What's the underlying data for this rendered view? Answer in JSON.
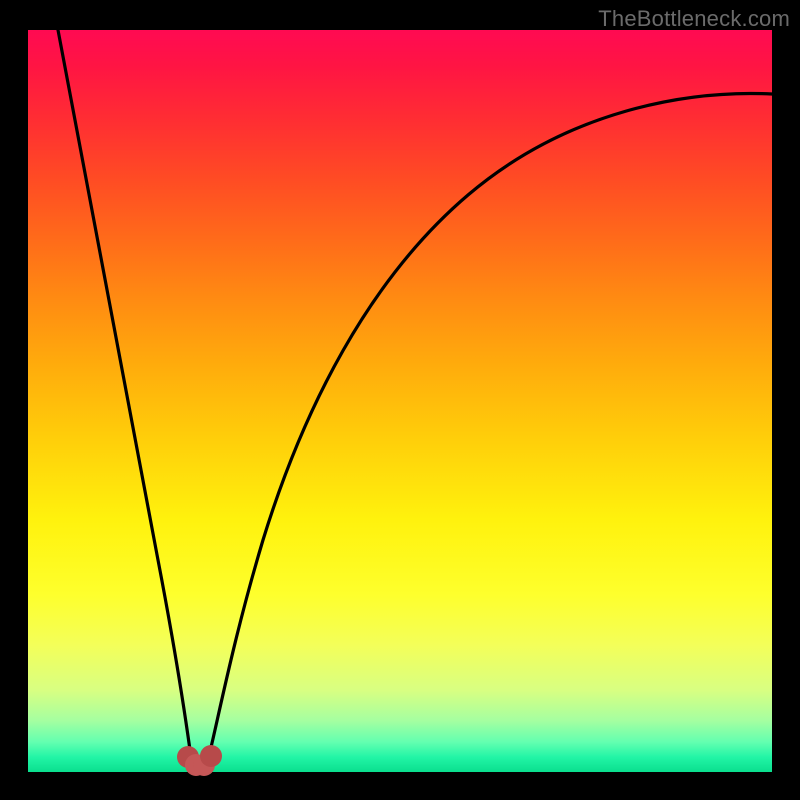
{
  "watermark": "TheBottleneck.com",
  "colors": {
    "frame": "#000000",
    "gradient_top": "#ff0a52",
    "gradient_bottom": "#0adf8e",
    "curve": "#000000",
    "marker_fill": "#b74a4a",
    "marker_fill_light": "#c55757"
  },
  "chart_data": {
    "type": "line",
    "title": "",
    "xlabel": "",
    "ylabel": "",
    "xlim": [
      0,
      100
    ],
    "ylim": [
      0,
      100
    ],
    "grid": false,
    "legend": false,
    "annotations": [
      "TheBottleneck.com"
    ],
    "series": [
      {
        "name": "left-branch",
        "x": [
          4.0,
          7.0,
          10.0,
          13.0,
          16.0,
          18.5,
          20.0,
          21.0,
          21.8
        ],
        "y": [
          100.0,
          82.0,
          65.0,
          48.0,
          32.0,
          18.5,
          9.5,
          4.0,
          1.2
        ]
      },
      {
        "name": "right-branch",
        "x": [
          24.2,
          25.5,
          28.0,
          32.0,
          38.0,
          45.0,
          54.0,
          64.0,
          76.0,
          88.0,
          100.0
        ],
        "y": [
          1.2,
          4.5,
          15.0,
          30.0,
          46.0,
          59.0,
          70.0,
          78.5,
          85.0,
          89.0,
          91.5
        ]
      },
      {
        "name": "valley-floor",
        "x": [
          21.8,
          22.4,
          23.0,
          23.6,
          24.2
        ],
        "y": [
          1.2,
          0.4,
          0.4,
          0.4,
          1.2
        ]
      }
    ],
    "markers": [
      {
        "x": 21.8,
        "y": 1.7,
        "r": 1.5
      },
      {
        "x": 22.5,
        "y": 0.6,
        "r": 1.5
      },
      {
        "x": 23.5,
        "y": 0.6,
        "r": 1.5
      },
      {
        "x": 24.3,
        "y": 1.8,
        "r": 1.5
      }
    ]
  }
}
